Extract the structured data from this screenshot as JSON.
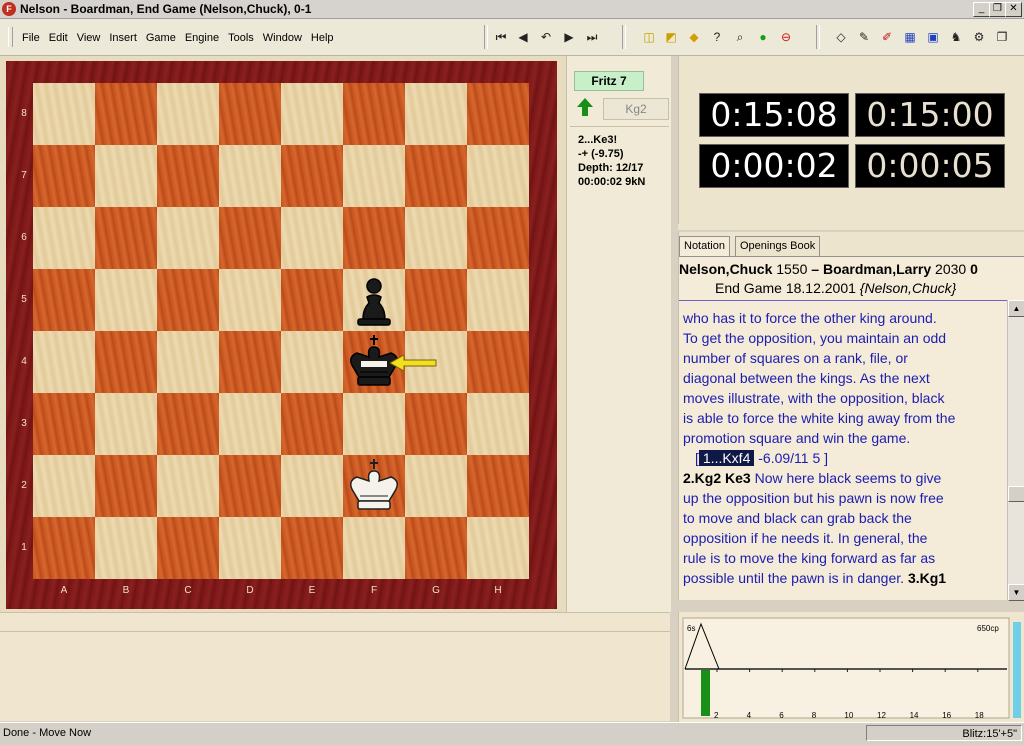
{
  "window": {
    "title": "Nelson - Boardman, End Game  (Nelson,Chuck), 0-1"
  },
  "menu": [
    "File",
    "Edit",
    "View",
    "Insert",
    "Game",
    "Engine",
    "Tools",
    "Window",
    "Help"
  ],
  "board": {
    "ranks": [
      "8",
      "7",
      "6",
      "5",
      "4",
      "3",
      "2",
      "1"
    ],
    "files": [
      "A",
      "B",
      "C",
      "D",
      "E",
      "F",
      "G",
      "H"
    ],
    "pieces": [
      {
        "type": "pawn",
        "color": "black",
        "square": "f5"
      },
      {
        "type": "king",
        "color": "black",
        "square": "f4"
      },
      {
        "type": "king",
        "color": "white",
        "square": "f2"
      }
    ]
  },
  "engine": {
    "name": "Fritz 7",
    "best_move": "Kg2",
    "line1": "2...Ke3!",
    "line2": "-+  (-9.75)",
    "line3": "Depth: 12/17",
    "line4": "00:00:02  9kN"
  },
  "clocks": {
    "top_left": "0:15:08",
    "top_right": "0:15:00",
    "bottom_left": "0:00:02",
    "bottom_right": "0:00:05"
  },
  "notation": {
    "tabs": [
      "Notation",
      "Openings Book"
    ],
    "white_player": "Nelson,Chuck",
    "white_elo": "1550",
    "dash": "–",
    "black_player": "Boardman,Larry",
    "black_elo": "2030",
    "result_partial": "0",
    "event": "End Game",
    "date": "18.12.2001",
    "annotator": "{Nelson,Chuck}",
    "text_lines": [
      "who has it to force the other king around.",
      "To get the opposition, you  maintain an odd",
      "number of squares on a rank, file, or",
      "diagonal between the kings.  As the next",
      "moves illustrate, with the opposition, black",
      "is able to force the white king away from the",
      "promotion square and win the game."
    ],
    "variation_open": "[",
    "variation_move": "1...Kxf4",
    "variation_eval": "-6.09/11",
    "variation_depth": "5",
    "variation_close": "]",
    "move2": "2.Kg2",
    "move2b": "Ke3",
    "line_after_move2": " Now here black seems to give",
    "text_lines2": [
      "up the opposition but his pawn is now free",
      "to move and black can grab back the",
      "opposition if he needs it.  In general, the",
      "rule is to move the king forward as far as"
    ],
    "last_line": "possible until the pawn is in danger.",
    "move3": "3.Kg1"
  },
  "graph": {
    "time_label": "6s",
    "cp_label": "650cp",
    "x_ticks": [
      "2",
      "4",
      "6",
      "8",
      "10",
      "12",
      "14",
      "16",
      "18"
    ]
  },
  "status": {
    "left": "Done - Move Now",
    "right": "Blitz:15'+5\""
  },
  "colors": {
    "frame": "#7a1616",
    "light_square": "#ecd9b0",
    "dark_square": "#c8531e",
    "clock_bg": "#000000",
    "notation_text": "#1c1cb0",
    "engine_tag": "#c8f0c8"
  }
}
